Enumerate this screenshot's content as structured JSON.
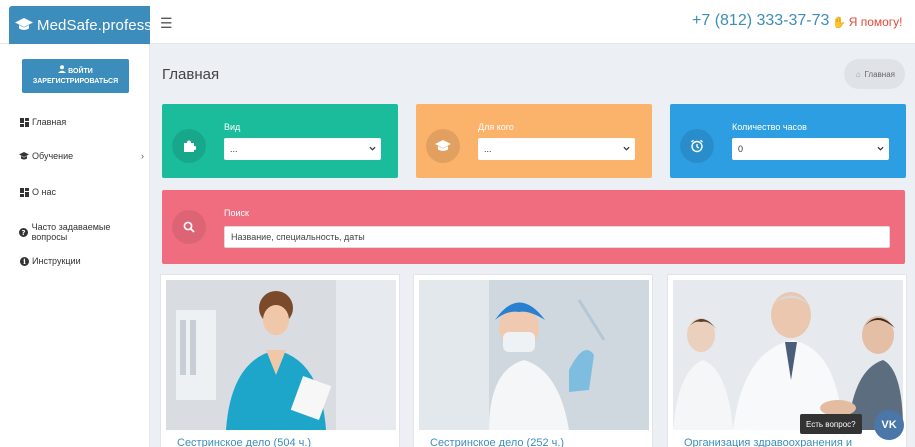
{
  "brand": {
    "name": "MedSafe.professor"
  },
  "header": {
    "phone": "+7 (812) 333-37-73",
    "help": "Я помогу!"
  },
  "sidebar": {
    "login_line1": "ВОЙТИ",
    "login_line2": "ЗАРЕГИСТРИРОВАТЬСЯ",
    "items": [
      {
        "label": "Главная"
      },
      {
        "label": "Обучение",
        "chevron": "›"
      },
      {
        "label": "О нас"
      },
      {
        "label": "Часто задаваемые вопросы"
      },
      {
        "label": "Инструкции"
      }
    ]
  },
  "page": {
    "title": "Главная",
    "breadcrumb": "Главная"
  },
  "filters": [
    {
      "label": "Вид",
      "value": "...",
      "color": "#1abc9c"
    },
    {
      "label": "Для кого",
      "value": "...",
      "color": "#fbb36b"
    },
    {
      "label": "Количество часов",
      "value": "0",
      "color": "#2e9ee3"
    }
  ],
  "search": {
    "label": "Поиск",
    "placeholder": "Название, специальность, даты",
    "color": "#f06d7f"
  },
  "cards": [
    {
      "caption": "Сестринское дело (504 ч.)"
    },
    {
      "caption": "Сестринское дело (252 ч.)"
    },
    {
      "caption": "Организация здравоохранения и"
    }
  ],
  "chat": {
    "tip": "Есть вопрос?",
    "vk": "VK"
  }
}
